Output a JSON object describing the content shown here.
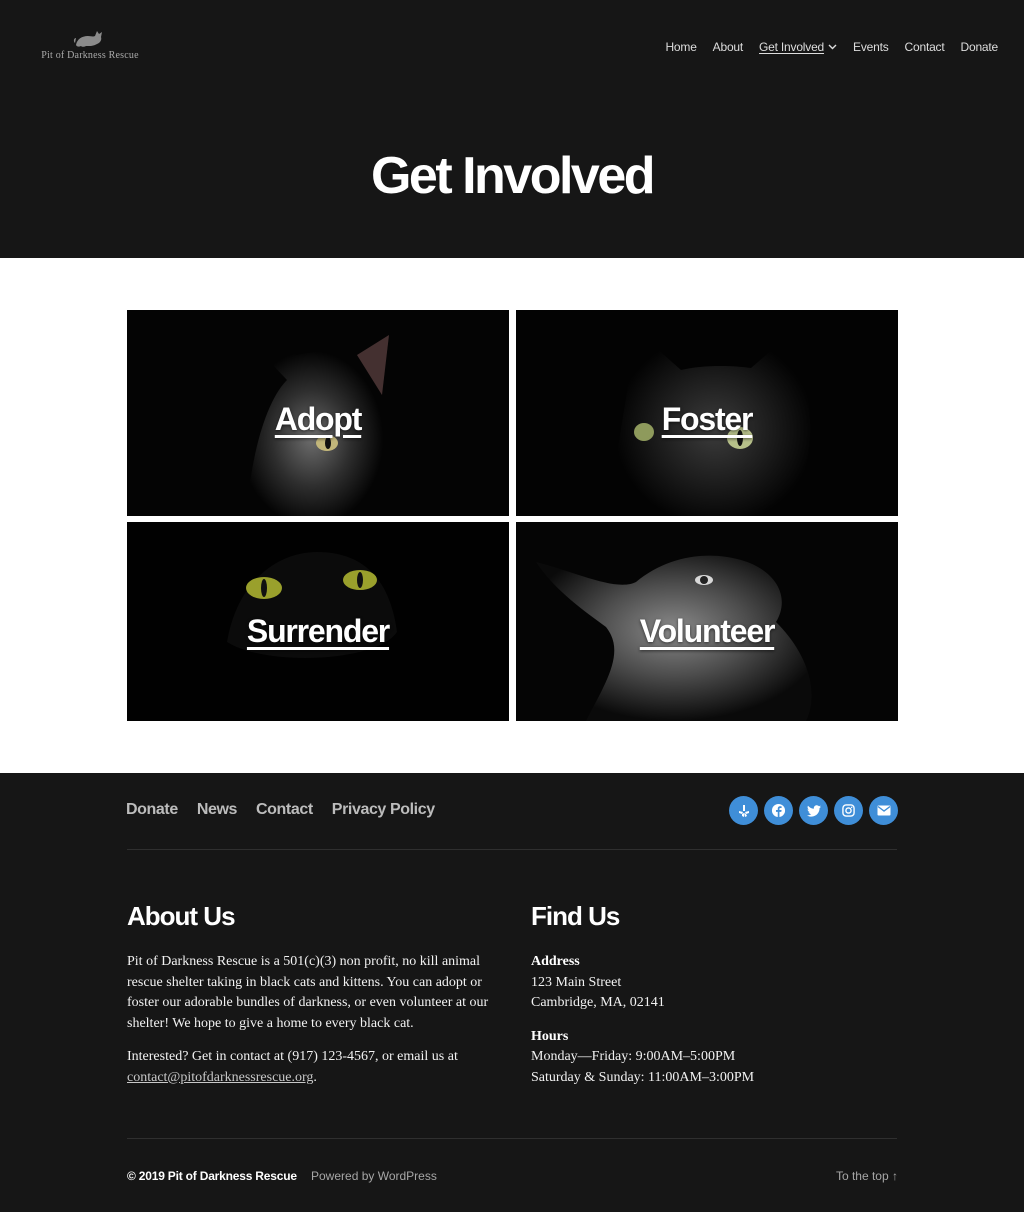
{
  "site": {
    "name": "Pit of Darkness Rescue"
  },
  "nav": {
    "items": [
      {
        "label": "Home"
      },
      {
        "label": "About"
      },
      {
        "label": "Get Involved"
      },
      {
        "label": "Events"
      },
      {
        "label": "Contact"
      },
      {
        "label": "Donate"
      }
    ]
  },
  "hero": {
    "title": "Get Involved"
  },
  "tiles": [
    {
      "label": "Adopt"
    },
    {
      "label": "Foster"
    },
    {
      "label": "Surrender"
    },
    {
      "label": "Volunteer"
    }
  ],
  "footer": {
    "nav": [
      "Donate",
      "News",
      "Contact",
      "Privacy Policy"
    ],
    "social_icons": [
      "yelp-icon",
      "facebook-icon",
      "twitter-icon",
      "instagram-icon",
      "mail-icon"
    ],
    "accent_color": "#3f8ed8",
    "about": {
      "heading": "About Us",
      "paragraph1": "Pit of Darkness Rescue is a 501(c)(3) non profit, no kill animal rescue shelter taking in black cats and kittens. You can adopt or foster our adorable bundles of darkness, or even volunteer at our shelter! We hope to give a home to every black cat.",
      "paragraph2_prefix": "Interested? Get in contact at (917) 123-4567, or email us at ",
      "email": "contact@pitofdarknessrescue.org",
      "paragraph2_suffix": "."
    },
    "find": {
      "heading": "Find Us",
      "address_label": "Address",
      "address_line1": "123 Main Street",
      "address_line2": "Cambridge, MA, 02141",
      "hours_label": "Hours",
      "hours_line1": "Monday—Friday: 9:00AM–5:00PM",
      "hours_line2": "Saturday & Sunday: 11:00AM–3:00PM"
    },
    "copyright": "© 2019 Pit of Darkness Rescue",
    "powered": "Powered by WordPress",
    "to_top": "To the top ↑"
  }
}
